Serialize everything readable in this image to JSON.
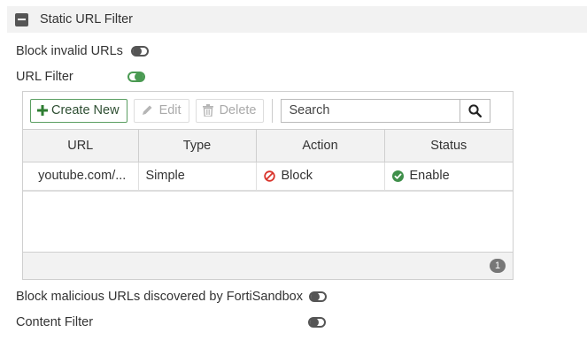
{
  "section": {
    "title": "Static URL Filter",
    "collapse_icon": "minus-square-icon"
  },
  "options": {
    "block_invalid_urls": {
      "label": "Block invalid URLs",
      "enabled": false
    },
    "url_filter": {
      "label": "URL Filter",
      "enabled": true
    },
    "block_malicious_urls": {
      "label": "Block malicious URLs discovered by FortiSandbox",
      "enabled": false
    },
    "content_filter": {
      "label": "Content Filter",
      "enabled": false
    }
  },
  "toolbar": {
    "create_new_label": "Create New",
    "edit_label": "Edit",
    "delete_label": "Delete",
    "search_placeholder": "Search"
  },
  "table": {
    "columns": [
      "URL",
      "Type",
      "Action",
      "Status"
    ],
    "rows": [
      {
        "url": "youtube.com/...",
        "type": "Simple",
        "action": "Block",
        "status": "Enable"
      }
    ],
    "count": "1"
  },
  "colors": {
    "accent_green": "#4a9a52",
    "block_red": "#d9342b",
    "enable_green": "#3f8f4a",
    "header_bg": "#f2f2f2"
  }
}
